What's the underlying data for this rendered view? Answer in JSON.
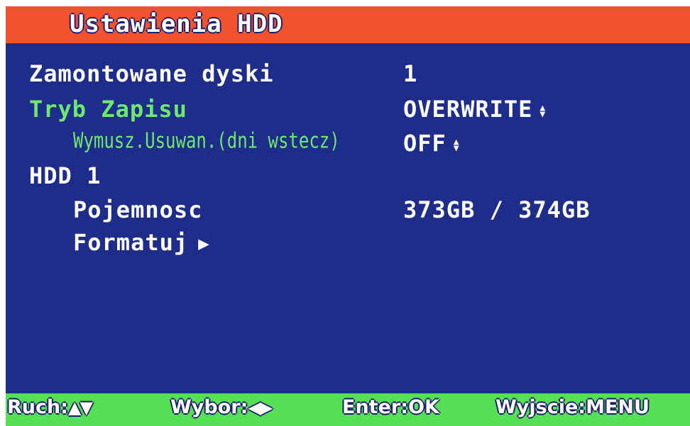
{
  "header": {
    "title": "Ustawienia HDD"
  },
  "settings": {
    "mounted_disks": {
      "label": "Zamontowane dyski",
      "value": "1"
    },
    "record_mode": {
      "label": "Tryb Zapisu",
      "value": "OVERWRITE"
    },
    "force_delete": {
      "label": "Wymusz.Usuwan.(dni wstecz)",
      "value": "OFF"
    },
    "hdd_label": "HDD 1",
    "capacity": {
      "label": "Pojemnosc",
      "value": "373GB / 374GB"
    },
    "format": {
      "label": "Formatuj"
    }
  },
  "footer": {
    "move_label": "Ruch:",
    "move_keys": "▲▼",
    "select_label": "Wybor:",
    "select_keys": "◀▶",
    "enter_label": "Enter:OK",
    "exit_label": "Wyjscie:MENU"
  },
  "icons": {
    "updown": "updown-icon",
    "play": "triangle-right-icon"
  },
  "colors": {
    "title_bar": "#f2532f",
    "background": "#1e2c8a",
    "highlight_text": "#6fe870",
    "footer_bar": "#55e055"
  }
}
